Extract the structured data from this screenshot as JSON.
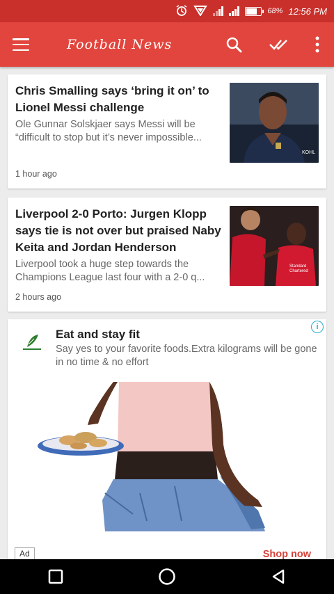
{
  "status": {
    "battery": "68%",
    "time": "12:56 PM",
    "battery_level": 0.68
  },
  "appbar": {
    "title": "Football News"
  },
  "articles": [
    {
      "headline": "Chris Smalling says ‘bring it on’ to Lionel Messi challenge",
      "summary": "Ole Gunnar Solskjaer says Messi will be “difficult to stop but it’s never impossible...",
      "time": "1 hour ago"
    },
    {
      "headline": "Liverpool 2-0 Porto: Jurgen Klopp says tie is not over but praised Naby Keita and Jordan Henderson",
      "summary": "Liverpool took a huge step towards the Champions League last four with a 2-0 q...",
      "time": "2 hours ago"
    }
  ],
  "ad": {
    "title": "Eat and stay fit",
    "description": "Say yes to your favorite foods.Extra kilograms will be gone in no time & no effort",
    "tag": "Ad",
    "cta": "Shop now"
  },
  "colors": {
    "appbar": "#e1453d",
    "statusbar": "#c9302b",
    "cta": "#d7423a"
  }
}
